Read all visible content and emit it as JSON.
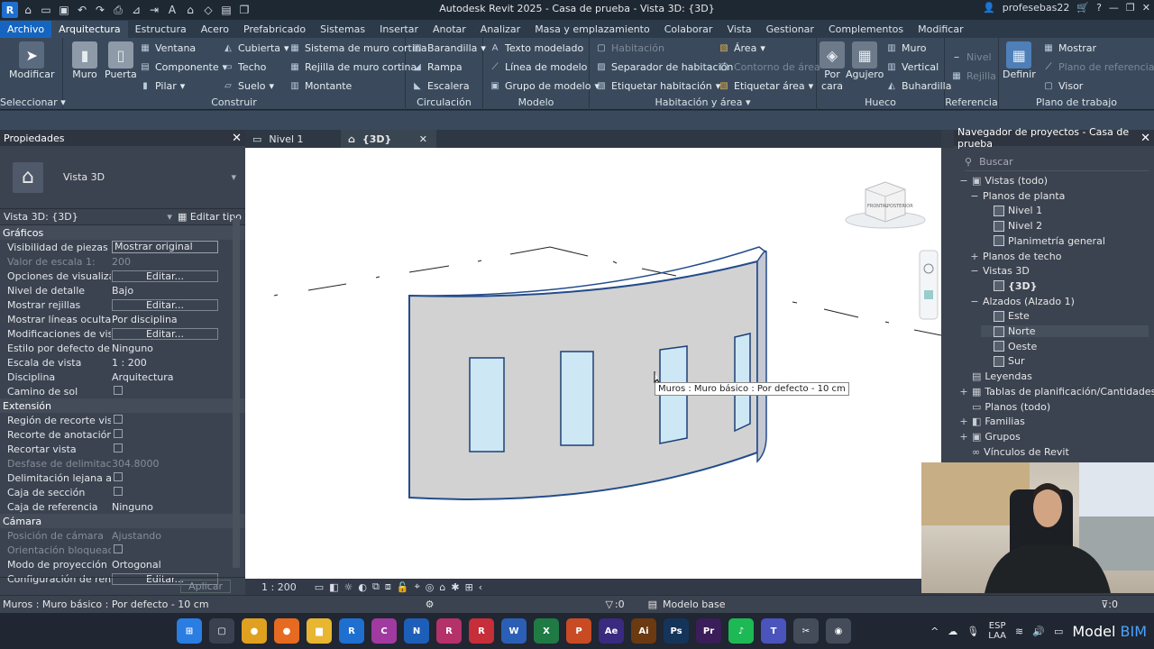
{
  "app": {
    "title": "Autodesk Revit 2025 - Casa de prueba - Vista 3D: {3D}",
    "user": "profesebas22",
    "logo_letter": "R"
  },
  "ribbon_tabs": [
    "Archivo",
    "Arquitectura",
    "Estructura",
    "Acero",
    "Prefabricado",
    "Sistemas",
    "Insertar",
    "Anotar",
    "Analizar",
    "Masa y emplazamiento",
    "Colaborar",
    "Vista",
    "Gestionar",
    "Complementos",
    "Modificar"
  ],
  "ribbon": {
    "modificar": "Modificar",
    "seleccionar": "Seleccionar",
    "construir": {
      "title": "Construir",
      "muro": "Muro",
      "puerta": "Puerta",
      "ventana": "Ventana",
      "componente": "Componente",
      "pilar": "Pilar",
      "cubierta": "Cubierta",
      "techo": "Techo",
      "suelo": "Suelo",
      "sistema_muro_cortina": "Sistema de muro cortina",
      "rejilla_muro_cortina": "Rejilla de muro cortina",
      "montante": "Montante"
    },
    "circulacion": {
      "title": "Circulación",
      "barandilla": "Barandilla",
      "rampa": "Rampa",
      "escalera": "Escalera"
    },
    "modelo": {
      "title": "Modelo",
      "texto_modelado": "Texto modelado",
      "linea_modelo": "Línea de modelo",
      "grupo_modelo": "Grupo de modelo"
    },
    "habitacion": {
      "title": "Habitación y área",
      "habitacion": "Habitación",
      "separador": "Separador de habitación",
      "etiquetar_habitacion": "Etiquetar habitación",
      "area": "Área",
      "contorno_area": "Contorno de área",
      "etiquetar_area": "Etiquetar área"
    },
    "hueco": {
      "title": "Hueco",
      "por_cara": "Por cara",
      "agujero": "Agujero",
      "muro": "Muro",
      "vertical": "Vertical",
      "buhardilla": "Buhardilla"
    },
    "referencia": {
      "title": "Referencia",
      "nivel": "Nivel",
      "rejilla": "Rejilla"
    },
    "plano_trabajo": {
      "title": "Plano de trabajo",
      "definir": "Definir",
      "mostrar": "Mostrar",
      "plano_referencia": "Plano de referencia",
      "visor": "Visor"
    }
  },
  "properties": {
    "title": "Propiedades",
    "type_name": "Vista 3D",
    "selector": "Vista 3D: {3D}",
    "edit_type": "Editar tipo",
    "apply": "Aplicar",
    "sections": [
      {
        "name": "Gráficos",
        "rows": [
          {
            "k": "Visibilidad de piezas",
            "v": "Mostrar original",
            "kind": "input"
          },
          {
            "k": "Valor de escala    1:",
            "v": "200",
            "kind": "text",
            "disabled": true
          },
          {
            "k": "Opciones de visualizaci...",
            "v": "Editar...",
            "kind": "button"
          },
          {
            "k": "Nivel de detalle",
            "v": "Bajo",
            "kind": "text"
          },
          {
            "k": "Mostrar rejillas",
            "v": "Editar...",
            "kind": "button"
          },
          {
            "k": "Mostrar líneas ocultas",
            "v": "Por disciplina",
            "kind": "text"
          },
          {
            "k": "Modificaciones de visibi...",
            "v": "Editar...",
            "kind": "button"
          },
          {
            "k": "Estilo por defecto de vis...",
            "v": "Ninguno",
            "kind": "text"
          },
          {
            "k": "Escala de vista",
            "v": "1 : 200",
            "kind": "text"
          },
          {
            "k": "Disciplina",
            "v": "Arquitectura",
            "kind": "text"
          },
          {
            "k": "Camino de sol",
            "v": "",
            "kind": "check"
          }
        ]
      },
      {
        "name": "Extensión",
        "rows": [
          {
            "k": "Región de recorte visible",
            "v": "",
            "kind": "check"
          },
          {
            "k": "Recorte de anotación",
            "v": "",
            "kind": "check"
          },
          {
            "k": "Recortar vista",
            "v": "",
            "kind": "check"
          },
          {
            "k": "Desfase de delimitación...",
            "v": "304.8000",
            "kind": "text",
            "disabled": true
          },
          {
            "k": "Delimitación lejana acti...",
            "v": "",
            "kind": "check"
          },
          {
            "k": "Caja de sección",
            "v": "",
            "kind": "check"
          },
          {
            "k": "Caja de referencia",
            "v": "Ninguno",
            "kind": "text"
          }
        ]
      },
      {
        "name": "Cámara",
        "rows": [
          {
            "k": "Posición de cámara",
            "v": "Ajustando",
            "kind": "text",
            "disabled": true
          },
          {
            "k": "Orientación bloqueada",
            "v": "",
            "kind": "check",
            "disabled": true
          },
          {
            "k": "Modo de proyección",
            "v": "Ortogonal",
            "kind": "text"
          },
          {
            "k": "Configuración de render...",
            "v": "Editar...",
            "kind": "button"
          }
        ]
      }
    ]
  },
  "view_tabs": [
    {
      "label": "Nivel 1",
      "active": false
    },
    {
      "label": "{3D}",
      "active": true
    }
  ],
  "viewport": {
    "tooltip": "Muros : Muro básico : Por defecto - 10 cm",
    "scale": "1 : 200",
    "viewcube": {
      "left": "FRONTAL",
      "right": "POSTERIOR"
    }
  },
  "browser": {
    "title": "Navegador de proyectos - Casa de prueba",
    "search_placeholder": "Buscar",
    "nodes": [
      {
        "label": "Vistas (todo)",
        "level": 0,
        "toggle": "−",
        "icon": "views"
      },
      {
        "label": "Planos de planta",
        "level": 1,
        "toggle": "−"
      },
      {
        "label": "Nivel 1",
        "level": 2,
        "icon": "view"
      },
      {
        "label": "Nivel 2",
        "level": 2,
        "icon": "view"
      },
      {
        "label": "Planimetría general",
        "level": 2,
        "icon": "view"
      },
      {
        "label": "Planos de techo",
        "level": 1,
        "toggle": "+"
      },
      {
        "label": "Vistas 3D",
        "level": 1,
        "toggle": "−"
      },
      {
        "label": "{3D}",
        "level": 2,
        "icon": "view",
        "bold": true
      },
      {
        "label": "Alzados (Alzado 1)",
        "level": 1,
        "toggle": "−"
      },
      {
        "label": "Este",
        "level": 2,
        "icon": "view"
      },
      {
        "label": "Norte",
        "level": 2,
        "icon": "view",
        "highlight": true
      },
      {
        "label": "Oeste",
        "level": 2,
        "icon": "view"
      },
      {
        "label": "Sur",
        "level": 2,
        "icon": "view"
      },
      {
        "label": "Leyendas",
        "level": 0,
        "icon": "legend"
      },
      {
        "label": "Tablas de planificación/Cantidades (todo)",
        "level": 0,
        "toggle": "+",
        "icon": "table"
      },
      {
        "label": "Planos (todo)",
        "level": 0,
        "icon": "sheet"
      },
      {
        "label": "Familias",
        "level": 0,
        "toggle": "+",
        "icon": "family"
      },
      {
        "label": "Grupos",
        "level": 0,
        "toggle": "+",
        "icon": "group"
      },
      {
        "label": "Vínculos de Revit",
        "level": 0,
        "icon": "link"
      }
    ]
  },
  "status": {
    "text": "Muros : Muro básico : Por defecto - 10 cm",
    "zero1": ":0",
    "model": "Modelo base",
    "zero2": ":0"
  },
  "taskbar": {
    "apps": [
      {
        "name": "start",
        "label": "⊞",
        "color": "#2a7de1"
      },
      {
        "name": "files",
        "label": "▢",
        "color": "#3a4150"
      },
      {
        "name": "chrome",
        "label": "●",
        "color": "#e0a020"
      },
      {
        "name": "firefox",
        "label": "●",
        "color": "#e66a20"
      },
      {
        "name": "explorer",
        "label": "▆",
        "color": "#e8b630"
      },
      {
        "name": "revit",
        "label": "R",
        "color": "#1f6fd0"
      },
      {
        "name": "civil",
        "label": "C",
        "color": "#a13aa0"
      },
      {
        "name": "navis",
        "label": "N",
        "color": "#1d5fb8"
      },
      {
        "name": "recap",
        "label": "R",
        "color": "#b4316a"
      },
      {
        "name": "revit-pro",
        "label": "R",
        "color": "#c62e3a"
      },
      {
        "name": "word",
        "label": "W",
        "color": "#2b5fb5"
      },
      {
        "name": "excel",
        "label": "X",
        "color": "#1f7a44"
      },
      {
        "name": "powerpoint",
        "label": "P",
        "color": "#c84b24"
      },
      {
        "name": "after-effects",
        "label": "Ae",
        "color": "#3a2a80"
      },
      {
        "name": "illustrator",
        "label": "Ai",
        "color": "#6b3a10"
      },
      {
        "name": "photoshop",
        "label": "Ps",
        "color": "#15345a"
      },
      {
        "name": "premiere",
        "label": "Pr",
        "color": "#3b1d5a"
      },
      {
        "name": "spotify",
        "label": "♪",
        "color": "#1db954"
      },
      {
        "name": "teams",
        "label": "T",
        "color": "#4b53bc"
      },
      {
        "name": "snip",
        "label": "✂",
        "color": "#444c5a"
      },
      {
        "name": "other",
        "label": "◉",
        "color": "#444c5a"
      }
    ],
    "lang": "ESP",
    "lang2": "LAA",
    "brand1": "Model",
    "brand2": "BIM"
  }
}
